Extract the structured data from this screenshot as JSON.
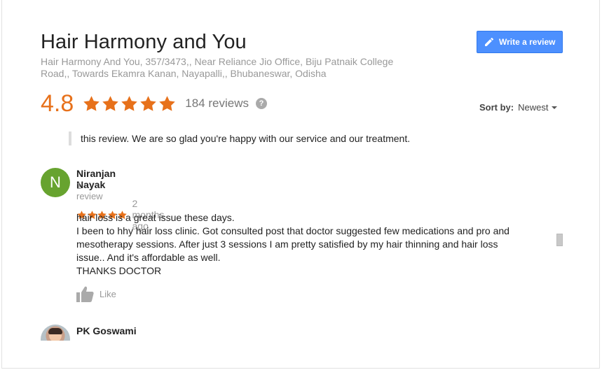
{
  "business": {
    "name": "Hair Harmony and You",
    "address_line1": "Hair Harmony And You, 357/3473,, Near Reliance Jio Office, Biju Patnaik College",
    "address_line2": "Road,, Towards Ekamra Kanan, Nayapalli,, Bhubaneswar, Odisha"
  },
  "actions": {
    "write_review": "Write a review"
  },
  "summary": {
    "rating": "4.8",
    "stars": 5,
    "reviews_count": "184 reviews",
    "help_glyph": "?"
  },
  "sort": {
    "label": "Sort by:",
    "value": "Newest"
  },
  "owner_reply_excerpt": "this review. We are so glad you're happy with our service and our treatment.",
  "reviews": [
    {
      "initial": "N",
      "name": "Niranjan Nayak",
      "meta": "1 review",
      "stars": 5,
      "date": "2 months ago",
      "lines": [
        "hair loss is a great issue these days.",
        "I been to hhy hair loss clinic.  Got consulted post that doctor suggested few medications and pro and",
        "mesotherapy sessions.  After just 3 sessions I am pretty satisfied by my hair thinning and hair loss",
        "issue.. And it's affordable as well.",
        "THANKS DOCTOR"
      ],
      "like_label": "Like"
    },
    {
      "name": "PK Goswami"
    }
  ],
  "colors": {
    "accent_orange": "#e7711b",
    "button_blue": "#4d90fe",
    "avatar_green": "#67a32f"
  },
  "icons": [
    "pencil-icon",
    "star-icon",
    "help-icon",
    "caret-down-icon",
    "thumbs-up-icon"
  ]
}
